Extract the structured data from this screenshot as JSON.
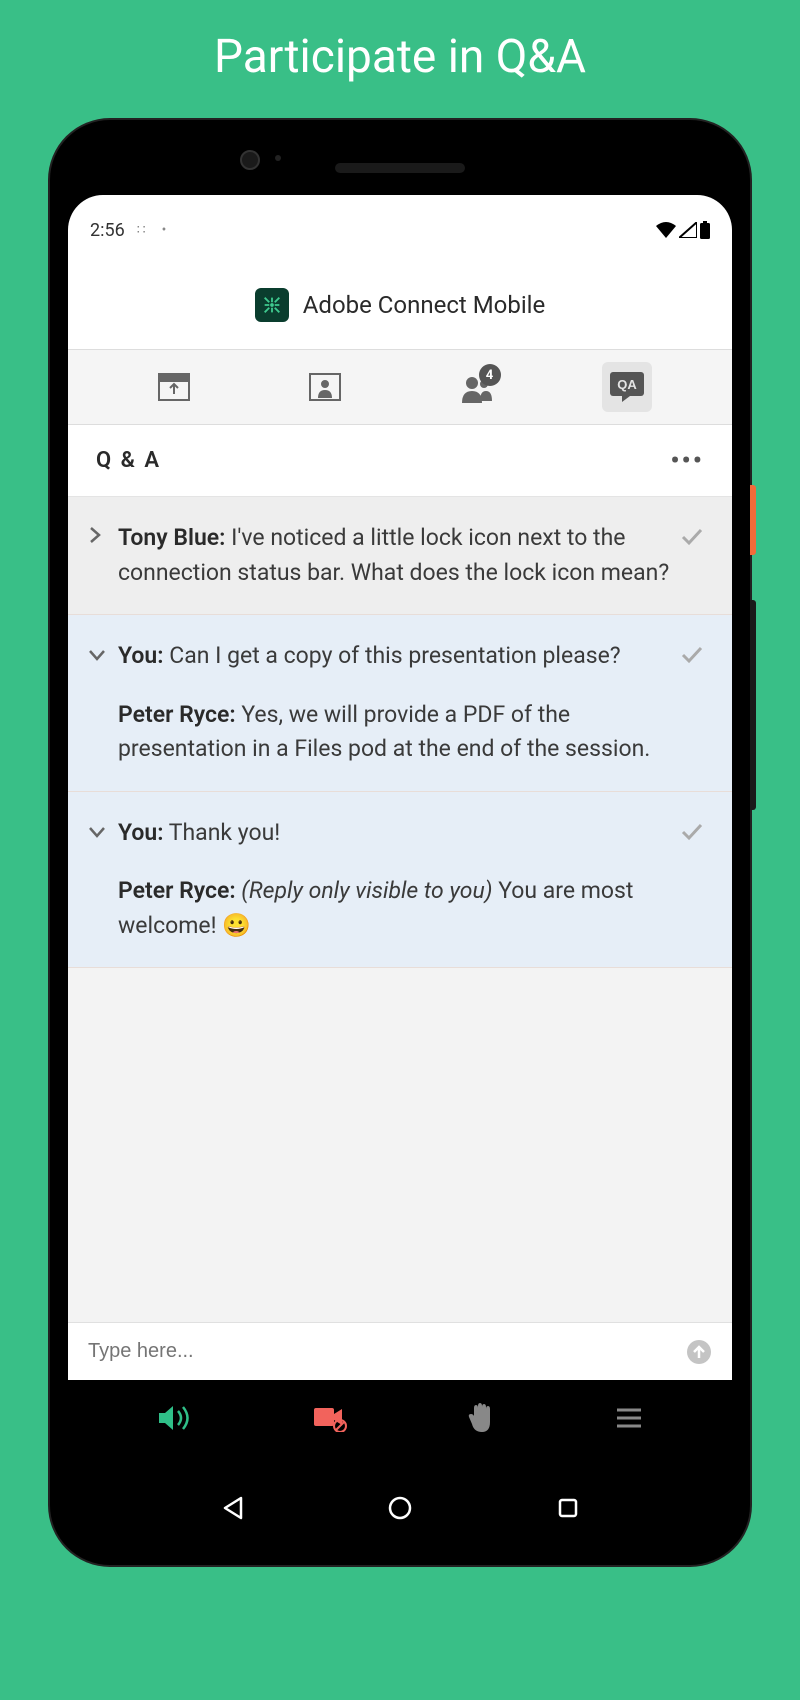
{
  "page": {
    "title": "Participate in Q&A"
  },
  "status": {
    "time": "2:56"
  },
  "app": {
    "title": "Adobe Connect Mobile"
  },
  "tabs": {
    "share_icon": "share-icon",
    "people_icon": "person-icon",
    "attendees_icon": "attendees-icon",
    "attendees_badge": "4",
    "qa_icon": "qa-icon"
  },
  "section": {
    "title": "Q & A"
  },
  "qa": [
    {
      "expanded": false,
      "author": "Tony Blue:",
      "text": " I've noticed a little lock icon next to the connection status bar. What does the lock icon mean?"
    },
    {
      "expanded": true,
      "author": "You:",
      "text": " Can I get a copy of this presentation please?",
      "reply_author": "Peter Ryce:",
      "reply_text": " Yes, we will provide a PDF of the presentation in a Files pod at the end of the session."
    },
    {
      "expanded": true,
      "author": "You:",
      "text": " Thank you!",
      "reply_author": "Peter Ryce:",
      "reply_note": " (Reply only visible to you) ",
      "reply_text": "You are most welcome! 😀"
    }
  ],
  "input": {
    "placeholder": "Type here..."
  }
}
